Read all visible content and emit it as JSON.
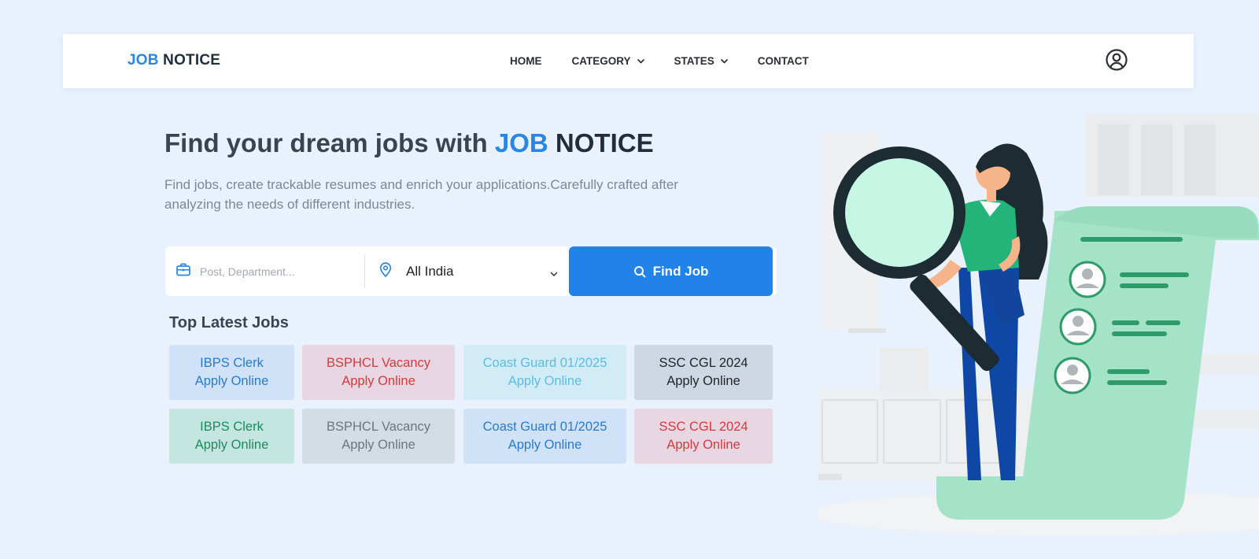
{
  "brand": {
    "part1": "JOB",
    "part2": "NOTICE"
  },
  "nav": {
    "items": [
      {
        "label": "HOME",
        "has_dropdown": false
      },
      {
        "label": "CATEGORY",
        "has_dropdown": true
      },
      {
        "label": "STATES",
        "has_dropdown": true
      },
      {
        "label": "CONTACT",
        "has_dropdown": false
      }
    ],
    "user_icon": "user-circle-icon"
  },
  "hero": {
    "title_prefix": "Find your dream jobs with",
    "title_blue": "JOB",
    "title_dark": "NOTICE",
    "subtitle": "Find jobs, create trackable resumes and enrich your applications.Carefully crafted after analyzing the needs of different industries."
  },
  "search": {
    "post_icon": "briefcase-icon",
    "post_placeholder": "Post, Department...",
    "post_value": "",
    "location_icon": "map-pin-icon",
    "location_value": "All India",
    "button_icon": "search-icon",
    "button_label": "Find Job"
  },
  "top_jobs": {
    "title": "Top Latest Jobs",
    "cards": [
      {
        "line1": "IBPS Clerk",
        "line2": "Apply Online",
        "bg": "#cfe2f7",
        "fg": "#2a7ac9"
      },
      {
        "line1": "BSPHCL Vacancy",
        "line2": "Apply Online",
        "bg": "#e8d6e2",
        "fg": "#d33a3a"
      },
      {
        "line1": "Coast Guard 01/2025",
        "line2": "Apply Online",
        "bg": "#d1ebf7",
        "fg": "#5bbde0"
      },
      {
        "line1": "SSC CGL 2024",
        "line2": "Apply Online",
        "bg": "#cdd8e2",
        "fg": "#212529"
      },
      {
        "line1": "IBPS Clerk",
        "line2": "Apply Online",
        "bg": "#c5e6e0",
        "fg": "#1c8a5e"
      },
      {
        "line1": "BSPHCL Vacancy",
        "line2": "Apply Online",
        "bg": "#d4dde6",
        "fg": "#6c757d"
      },
      {
        "line1": "Coast Guard 01/2025",
        "line2": "Apply Online",
        "bg": "#cfe2f7",
        "fg": "#2a7ac9"
      },
      {
        "line1": "SSC CGL 2024",
        "line2": "Apply Online",
        "bg": "#e8d6e2",
        "fg": "#d33a3a"
      }
    ]
  },
  "colors": {
    "accent": "#2183ea",
    "brand_blue": "#2a86e0",
    "page_bg": "#e8f1fc"
  }
}
